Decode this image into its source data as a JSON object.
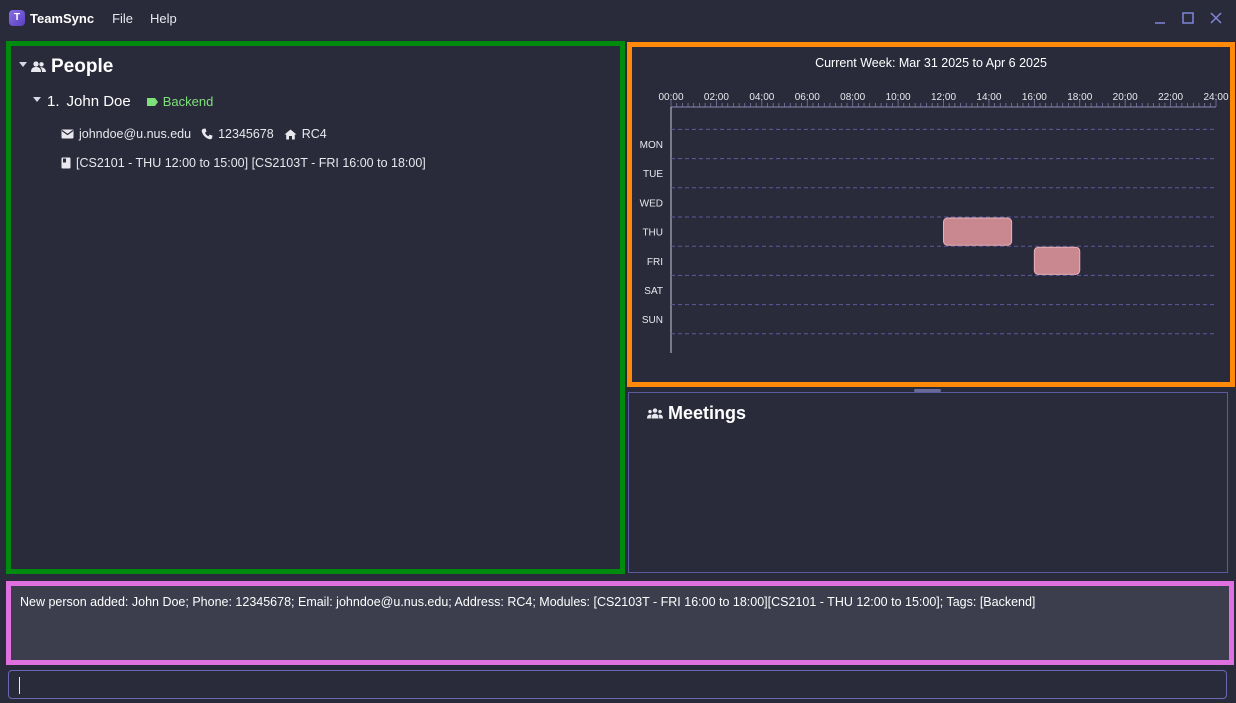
{
  "app": {
    "name": "TeamSync"
  },
  "menu": {
    "file": "File",
    "help": "Help"
  },
  "window_controls": {
    "minimize": "_",
    "maximize": "☐",
    "close": "✕"
  },
  "people": {
    "title": "People",
    "persons": [
      {
        "index": "1.",
        "name": "John Doe",
        "tag": "Backend",
        "email": "johndoe@u.nus.edu",
        "phone": "12345678",
        "address": "RC4",
        "modules": "[CS2101 - THU 12:00 to 15:00] [CS2103T - FRI 16:00 to 18:00]"
      }
    ]
  },
  "calendar": {
    "title": "Current Week: Mar 31 2025 to Apr 6 2025",
    "hour_labels": [
      "00:00",
      "02:00",
      "04:00",
      "06:00",
      "08:00",
      "10:00",
      "12:00",
      "14:00",
      "16:00",
      "18:00",
      "20:00",
      "22:00",
      "24:00"
    ],
    "days": [
      "MON",
      "TUE",
      "WED",
      "THU",
      "FRI",
      "SAT",
      "SUN"
    ],
    "events": [
      {
        "day": "THU",
        "start": 12,
        "end": 15
      },
      {
        "day": "FRI",
        "start": 16,
        "end": 18
      }
    ],
    "event_color": "#c98890"
  },
  "meetings": {
    "title": "Meetings"
  },
  "result": {
    "message": "New person added: John Doe; Phone: 12345678; Email: johndoe@u.nus.edu; Address: RC4; Modules: [CS2103T - FRI 16:00 to 18:00][CS2101 - THU 12:00 to 15:00]; Tags: [Backend]"
  },
  "command": {
    "value": ""
  },
  "colors": {
    "people_border": "#008a0e",
    "calendar_border": "#ff8a0a",
    "result_border": "#e06fe0",
    "tag_text": "#7ee07a"
  }
}
